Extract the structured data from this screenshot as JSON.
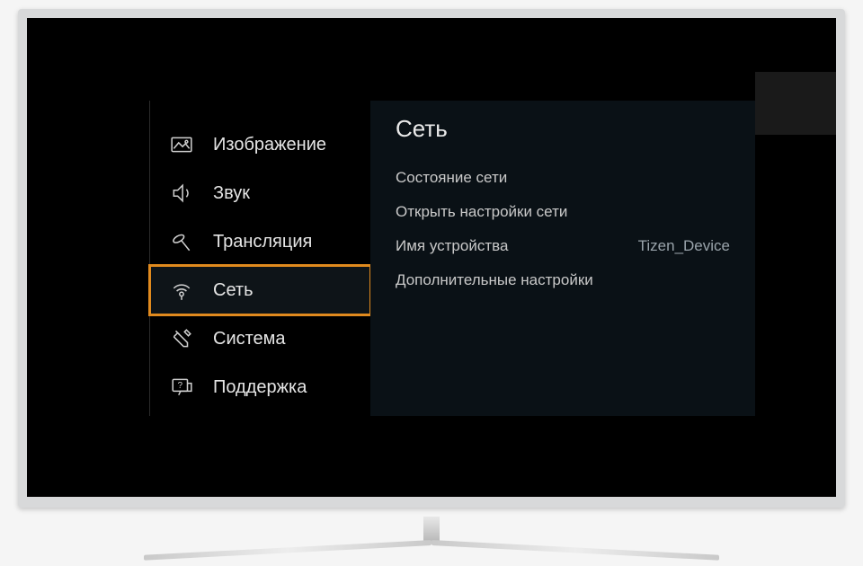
{
  "sidebar": {
    "items": [
      {
        "label": "Изображение",
        "icon": "image-icon",
        "selected": false
      },
      {
        "label": "Звук",
        "icon": "sound-icon",
        "selected": false
      },
      {
        "label": "Трансляция",
        "icon": "broadcast-icon",
        "selected": false
      },
      {
        "label": "Сеть",
        "icon": "network-icon",
        "selected": true
      },
      {
        "label": "Система",
        "icon": "system-icon",
        "selected": false
      },
      {
        "label": "Поддержка",
        "icon": "support-icon",
        "selected": false
      }
    ]
  },
  "content": {
    "title": "Сеть",
    "rows": [
      {
        "label": "Состояние сети",
        "value": ""
      },
      {
        "label": "Открыть настройки сети",
        "value": ""
      },
      {
        "label": "Имя устройства",
        "value": "Tizen_Device"
      },
      {
        "label": "Дополнительные настройки",
        "value": ""
      }
    ]
  },
  "colors": {
    "highlight": "#e08a1e",
    "panel": "#0a1116"
  }
}
